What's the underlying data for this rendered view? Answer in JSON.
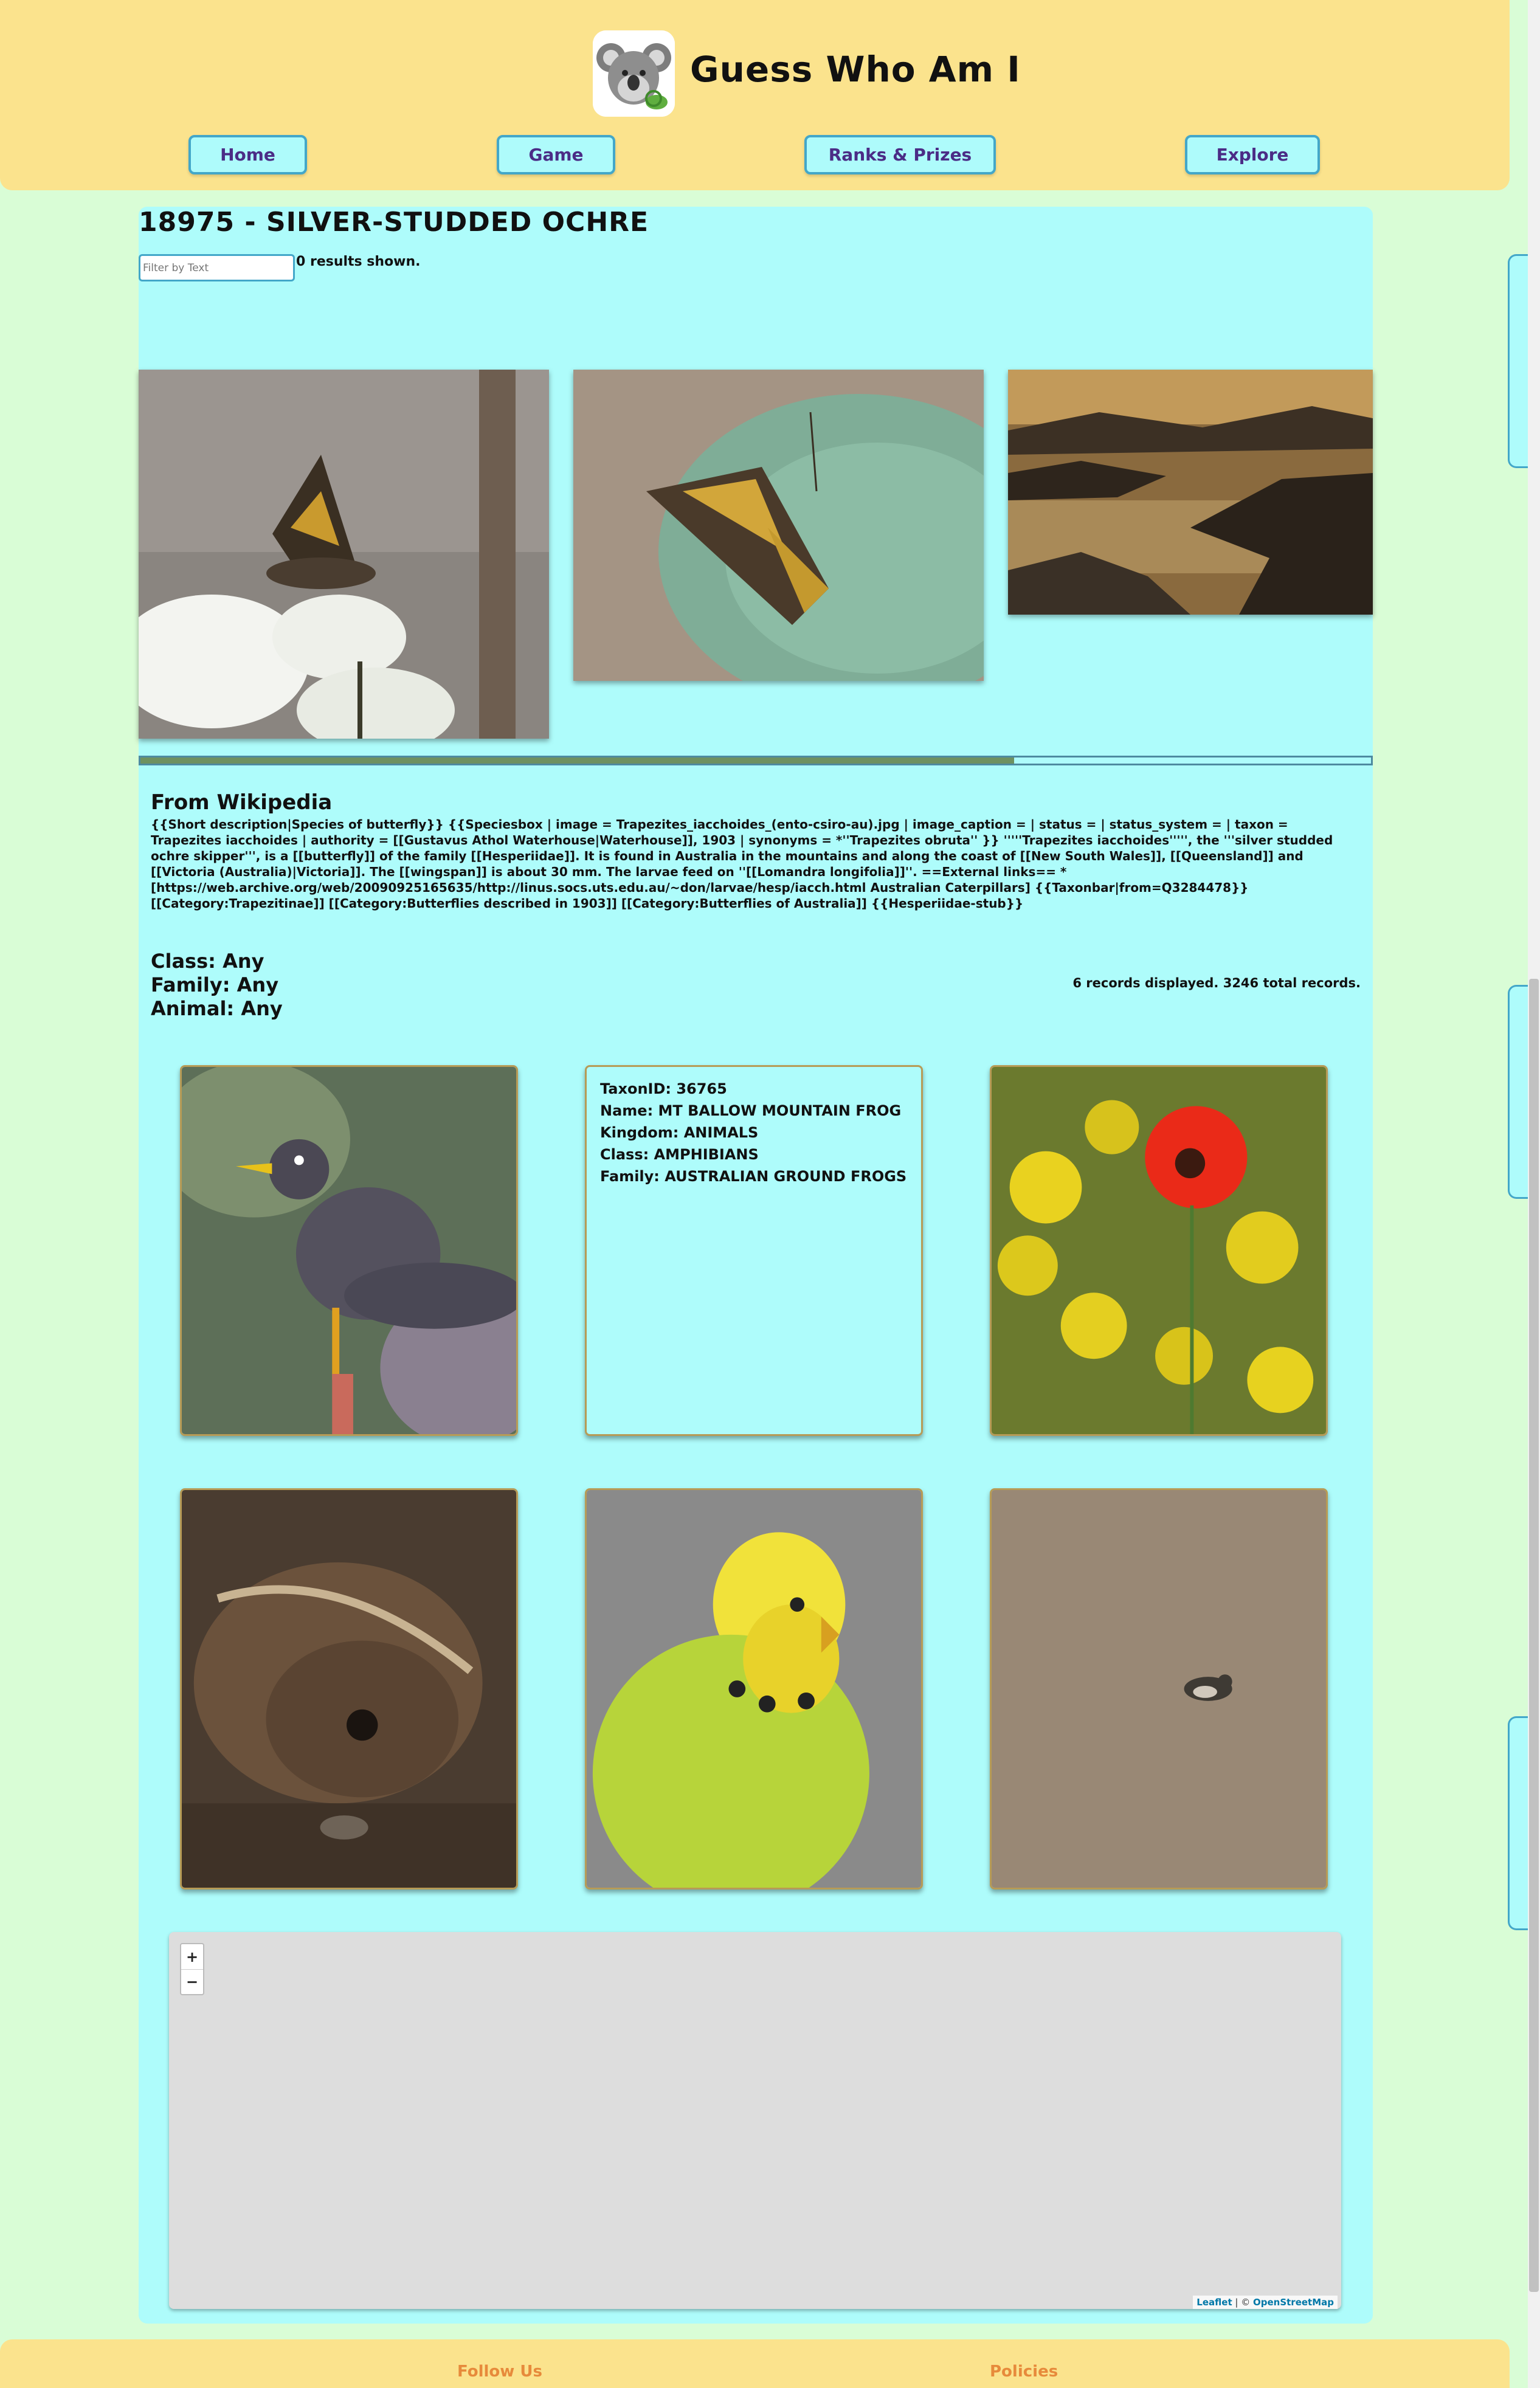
{
  "app": {
    "title": "Guess Who Am I",
    "logo_icon": "koala-logo-icon"
  },
  "nav": {
    "items": [
      {
        "label": "Home"
      },
      {
        "label": "Game"
      },
      {
        "label": "Ranks & Prizes"
      },
      {
        "label": "Explore"
      }
    ]
  },
  "species": {
    "title": "18975 - SILVER-STUDDED OCHRE",
    "filter_placeholder": "Filter by Text",
    "results_shown": "0 results shown.",
    "gallery": [
      {
        "alt": "butterfly-on-white-flowers"
      },
      {
        "alt": "butterfly-on-leaf"
      },
      {
        "alt": "coastal-sunset-landscape"
      }
    ],
    "progress": 0.71
  },
  "wikipedia": {
    "heading": "From Wikipedia",
    "text": "{{Short description|Species of butterfly}} {{Speciesbox | image = Trapezites_iacchoides_(ento-csiro-au).jpg | image_caption = | status = | status_system = | taxon = Trapezites iacchoides | authority = [[Gustavus Athol Waterhouse|Waterhouse]], 1903 | synonyms = *''Trapezites obruta'' }} '''''Trapezites iacchoides''''', the '''silver studded ochre skipper''', is a [[butterfly]] of the family [[Hesperiidae]]. It is found in Australia in the mountains and along the coast of [[New South Wales]], [[Queensland]] and [[Victoria (Australia)|Victoria]]. The [[wingspan]] is about 30 mm. The larvae feed on ''[[Lomandra longifolia]]''. ==External links== * [https://web.archive.org/web/20090925165635/http://linus.socs.uts.edu.au/~don/larvae/hesp/iacch.html Australian Caterpillars] {{Taxonbar|from=Q3284478}} [[Category:Trapezitinae]] [[Category:Butterflies described in 1903]] [[Category:Butterflies of Australia]] {{Hesperiidae-stub}}"
  },
  "filters": {
    "class": "Class: Any",
    "family": "Family: Any",
    "animal": "Animal: Any",
    "records": "6 records displayed. 3246 total records."
  },
  "cards": [
    {
      "type": "image",
      "alt": "myna-bird"
    },
    {
      "type": "info",
      "taxon_id": "TaxonID: 36765",
      "name": "Name: MT BALLOW MOUNTAIN FROG",
      "kingdom": "Kingdom: ANIMALS",
      "class": "Class: AMPHIBIANS",
      "family": "Family: AUSTRALIAN GROUND FROGS"
    },
    {
      "type": "image",
      "alt": "red-poppy-yellow-flowers"
    },
    {
      "type": "image",
      "alt": "brown-frog"
    },
    {
      "type": "image",
      "alt": "budgerigar"
    },
    {
      "type": "image",
      "alt": "small-bird-on-ground"
    }
  ],
  "map": {
    "zoom_in": "+",
    "zoom_out": "−",
    "attribution_leaflet": "Leaflet",
    "attribution_sep": " | © ",
    "attribution_osm": "OpenStreetMap"
  },
  "footer": {
    "follow": "Follow Us",
    "policies": "Policies"
  },
  "colors": {
    "background": "#d9fdd6",
    "header": "#fbe38d",
    "panel": "#aefcfb",
    "nav_border": "#43a7c9",
    "nav_text": "#4b2c86",
    "footer_link": "#e78a3b"
  }
}
